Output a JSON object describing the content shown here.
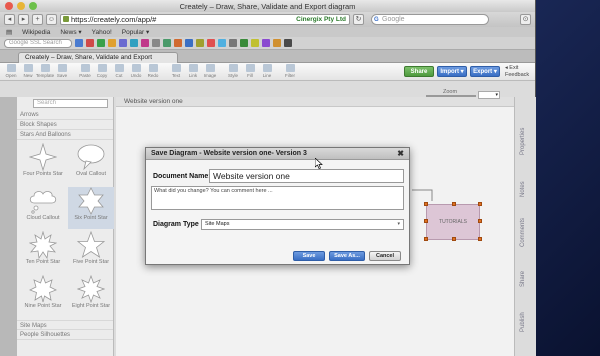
{
  "window": {
    "title": "Creately – Draw, Share, Validate and Export diagram",
    "url": "https://creately.com/app/#",
    "site_identity": "Cinergix Pty Ltd",
    "search_placeholder": "Google"
  },
  "bookmarks": [
    "Wikipedia",
    "News ▾",
    "Yahoo!",
    "Popular ▾"
  ],
  "extbar": {
    "search_placeholder": "Google SSL Search"
  },
  "tab": {
    "label": "Creately – Draw, Share, Validate and Export diagram"
  },
  "toolbar": {
    "tools": [
      "Open",
      "New",
      "Template",
      "Save",
      "Paste",
      "Copy",
      "Cut",
      "Undo",
      "Redo",
      "Text",
      "Link",
      "Image",
      "Style",
      "Fill",
      "Line",
      "Filter"
    ],
    "share_label": "Share",
    "import_label": "Import ▾",
    "export_label": "Export ▾",
    "exit_label": "◂ Exit",
    "feedback_label": "Feedback"
  },
  "sidebar": {
    "search_placeholder": "Search",
    "sections": [
      "Arrows",
      "Block Shapes",
      "Stars And Balloons"
    ],
    "shapes": [
      "Four Points Star",
      "Oval Callout",
      "Cloud Callout",
      "Six Point Star",
      "Ten Point Star",
      "Five Point Star",
      "Nine Point Star",
      "Eight Point Star"
    ],
    "footer_sections": [
      "Site Maps",
      "People Silhouettes"
    ]
  },
  "canvas": {
    "tab_label": "Website version one",
    "zoom_label": "Zoom",
    "node_label": "TUTORIALS"
  },
  "right_panel": [
    "Properties",
    "Notes",
    "Comments",
    "Share",
    "Publish"
  ],
  "dialog": {
    "title": "Save Diagram - Website version one- Version 3",
    "close_label": "✖",
    "doc_name_label": "Document Name:",
    "doc_name_value": "Website version one",
    "comment_placeholder": "What did you change? You can comment here ...",
    "diagram_type_label": "Diagram Type",
    "diagram_type_value": "Site Maps",
    "save_label": "Save",
    "save_as_label": "Save As...",
    "cancel_label": "Cancel"
  },
  "colors": {
    "accent_blue": "#3a6fc4",
    "green_button": "#55a644",
    "node_fill": "#ddc6d6",
    "handle": "#e07020"
  }
}
